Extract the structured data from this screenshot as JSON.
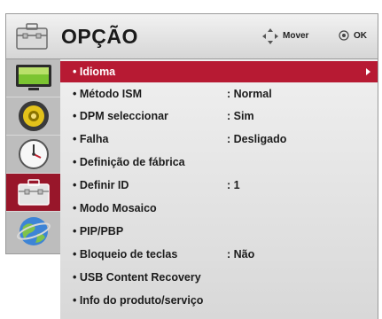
{
  "header": {
    "title": "OPÇÃO",
    "hint_move": "Mover",
    "hint_ok": "OK"
  },
  "sidebar": {
    "items": [
      {
        "icon": "picture-icon"
      },
      {
        "icon": "audio-icon"
      },
      {
        "icon": "time-icon"
      },
      {
        "icon": "option-icon",
        "active": true
      },
      {
        "icon": "network-icon"
      }
    ]
  },
  "menu": {
    "items": [
      {
        "label": "• Idioma",
        "value": "",
        "selected": true
      },
      {
        "label": "• Método ISM",
        "value": ": Normal"
      },
      {
        "label": "• DPM seleccionar",
        "value": ": Sim"
      },
      {
        "label": "• Falha",
        "value": ": Desligado"
      },
      {
        "label": "• Definição de fábrica",
        "value": ""
      },
      {
        "label": "• Definir ID",
        "value": ": 1"
      },
      {
        "label": "• Modo Mosaico",
        "value": ""
      },
      {
        "label": "• PIP/PBP",
        "value": ""
      },
      {
        "label": "• Bloqueio de teclas",
        "value": ": Não"
      },
      {
        "label": "• USB Content Recovery",
        "value": ""
      },
      {
        "label": "• Info do produto/serviço",
        "value": ""
      }
    ]
  },
  "colors": {
    "selected_row": "#b71a33",
    "active_category": "#98162a"
  }
}
